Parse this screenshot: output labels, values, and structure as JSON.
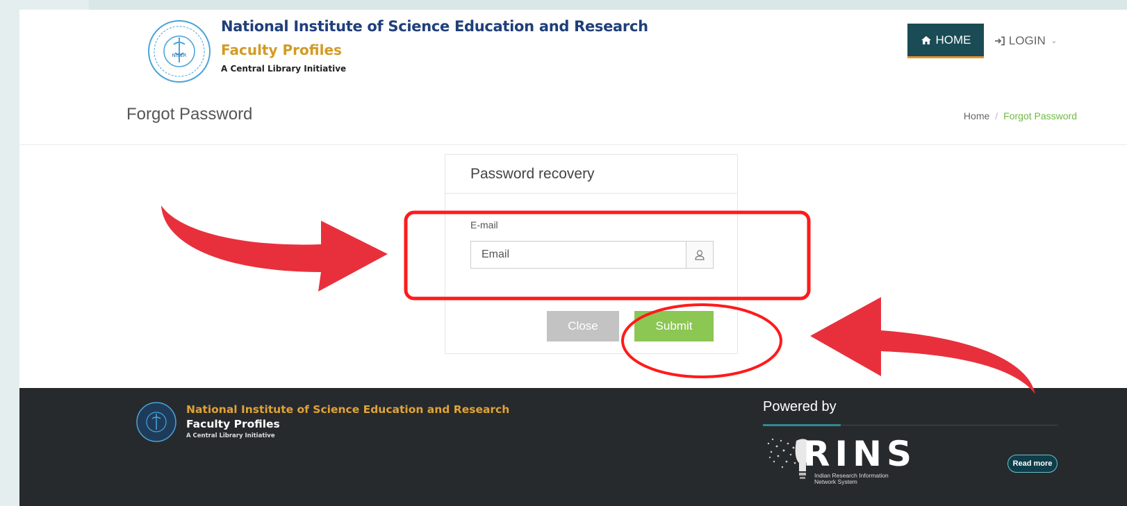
{
  "header": {
    "org_name": "National Institute of Science Education and Research",
    "site_name": "Faculty Profiles",
    "site_tagline": "A Central Library Initiative",
    "logo_text": "NISER",
    "nav": {
      "home_label": "HOME",
      "login_label": "LOGIN"
    }
  },
  "page": {
    "title": "Forgot Password",
    "breadcrumb": [
      "Home",
      "Forgot Password"
    ]
  },
  "recovery_card": {
    "title": "Password recovery",
    "email_label": "E-mail",
    "email_placeholder": "Email",
    "email_value": "",
    "close_label": "Close",
    "submit_label": "Submit"
  },
  "footer": {
    "org_name": "National Institute of Science Education and Research",
    "site_name": "Faculty Profiles",
    "site_tagline": "A Central Library Initiative",
    "powered_by_label": "Powered by",
    "irins_name": "RINS",
    "irins_tagline_1": "Indian Research Information",
    "irins_tagline_2": "Network System",
    "read_more_label": "Read more"
  },
  "colors": {
    "brand_navy": "#1f3f7a",
    "brand_gold": "#d39a24",
    "nav_active": "#1b4b55",
    "accent_orange": "#e6932a",
    "submit_green": "#8cc653",
    "close_gray": "#c3c3c3",
    "breadcrumb_active": "#6dbb3e",
    "footer_bg": "#272a2c",
    "annotation_red": "#e8303c"
  },
  "icons": {
    "home": "home-icon",
    "login": "sign-in-icon",
    "email_addon": "user-icon"
  }
}
